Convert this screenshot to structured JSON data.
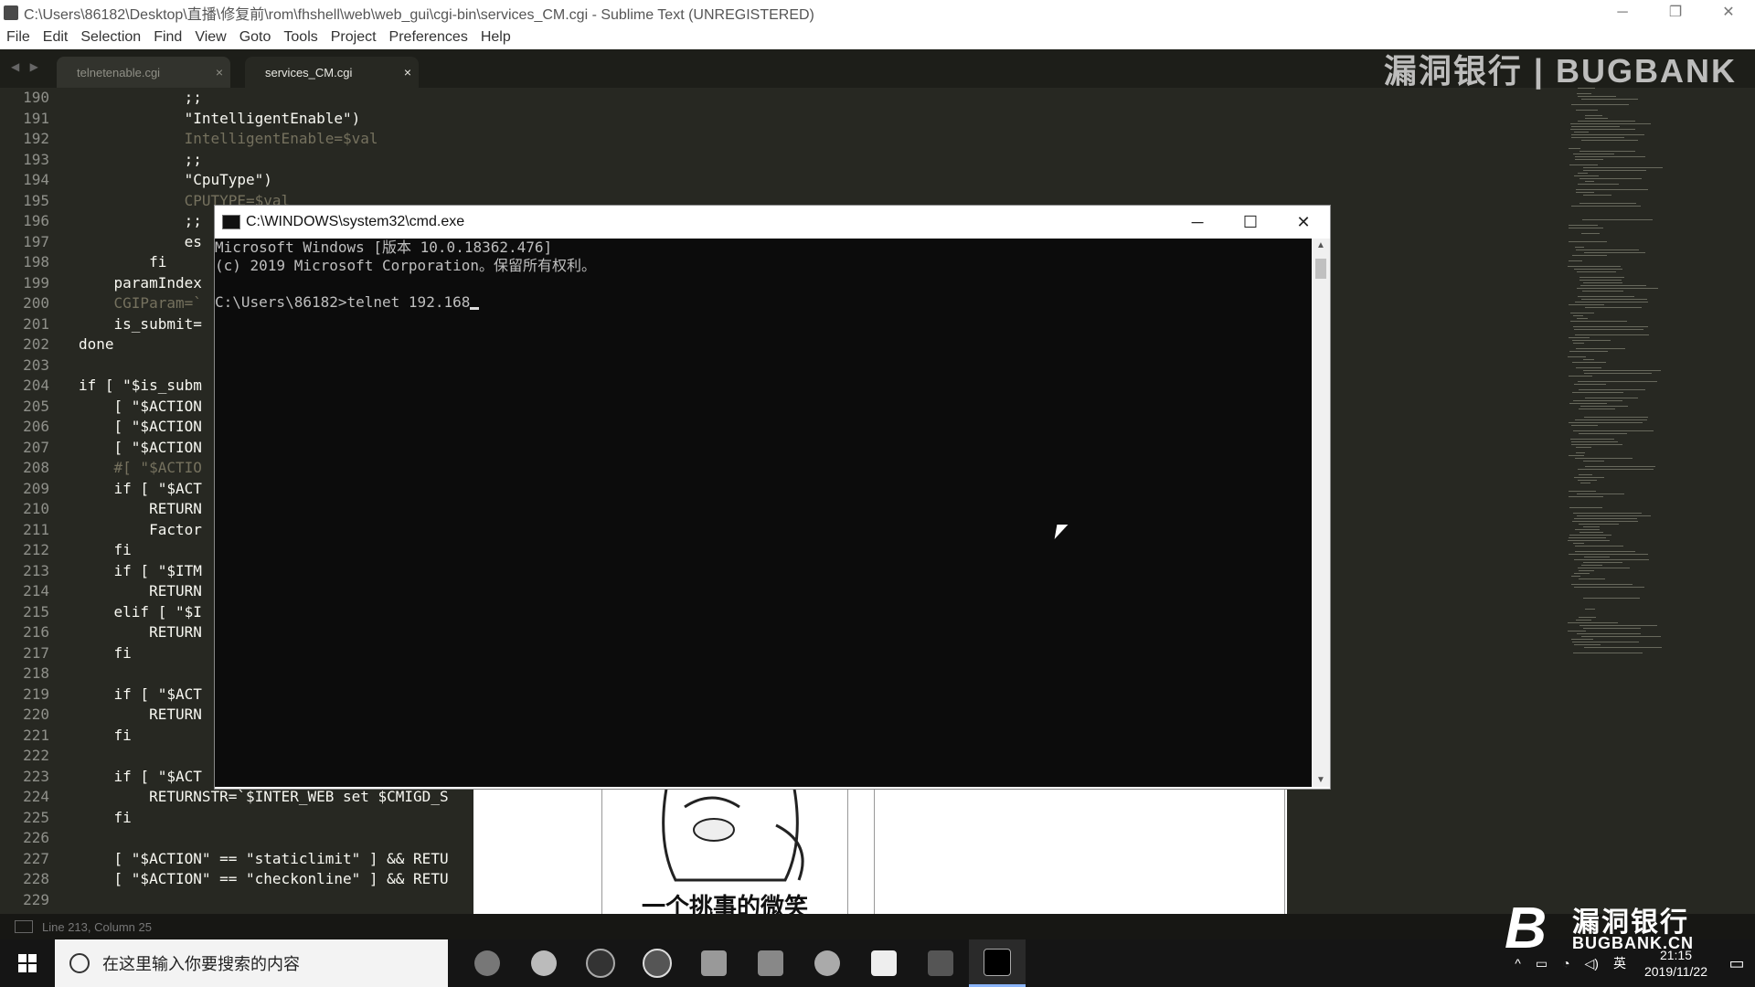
{
  "window": {
    "title": "C:\\Users\\86182\\Desktop\\直播\\修复前\\rom\\fhshell\\web\\web_gui\\cgi-bin\\services_CM.cgi - Sublime Text (UNREGISTERED)",
    "controls": [
      "─",
      "❐",
      "✕"
    ]
  },
  "menu": [
    "File",
    "Edit",
    "Selection",
    "Find",
    "View",
    "Goto",
    "Tools",
    "Project",
    "Preferences",
    "Help"
  ],
  "tabs": [
    {
      "label": "telnetenable.cgi",
      "close": "×"
    },
    {
      "label": "services_CM.cgi",
      "close": "×"
    }
  ],
  "tab_nav": "◀ ▶",
  "watermark_top": "漏洞银行 | BUGBANK",
  "editor": {
    "line_numbers": [
      "190",
      "191",
      "192",
      "193",
      "194",
      "195",
      "196",
      "197",
      "198",
      "199",
      "200",
      "201",
      "202",
      "203",
      "204",
      "205",
      "206",
      "207",
      "208",
      "209",
      "210",
      "211",
      "212",
      "213",
      "214",
      "215",
      "216",
      "217",
      "218",
      "219",
      "220",
      "221",
      "222",
      "223",
      "224",
      "225",
      "226",
      "227",
      "228",
      "229"
    ],
    "lines": [
      "            ;;",
      "            \"IntelligentEnable\")",
      "            IntelligentEnable=$val",
      "            ;;",
      "            \"CpuType\")",
      "            CPUTYPE=$val",
      "            ;;",
      "            es",
      "        fi",
      "    paramIndex",
      "    CGIParam=`",
      "    is_submit=",
      "done",
      "",
      "if [ \"$is_subm",
      "    [ \"$ACTION",
      "    [ \"$ACTION",
      "    [ \"$ACTION",
      "    #[ \"$ACTIO",
      "    if [ \"$ACT",
      "        RETURN",
      "        Factor",
      "    fi",
      "    if [ \"$ITM",
      "        RETURN",
      "    elif [ \"$I",
      "        RETURN",
      "    fi",
      "",
      "    if [ \"$ACT",
      "        RETURN",
      "    fi",
      "",
      "    if [ \"$ACT",
      "        RETURNSTR=`$INTER_WEB set $CMIGD_S",
      "    fi",
      "",
      "    [ \"$ACTION\" == \"staticlimit\" ] && RETU",
      "    [ \"$ACTION\" == \"checkonline\" ] && RETU",
      ""
    ]
  },
  "status": "Line 213, Column 25",
  "cmd": {
    "title": "C:\\WINDOWS\\system32\\cmd.exe",
    "controls": [
      "─",
      "☐",
      "✕"
    ],
    "lines": [
      "Microsoft Windows [版本 10.0.18362.476]",
      "(c) 2019 Microsoft Corporation。保留所有权利。",
      "",
      "C:\\Users\\86182>telnet 192.168"
    ]
  },
  "sticker": {
    "caption": "一个挑事的微笑"
  },
  "taskbar": {
    "search_placeholder": "在这里输入你要搜索的内容",
    "tray_icons": [
      "^",
      "▭",
      "◔",
      "◁)",
      "英"
    ],
    "time": "21:15",
    "date": "2019/11/22",
    "notification": "▭"
  },
  "watermark_br": {
    "logo": "B",
    "line1": "漏洞银行",
    "line2": "BUGBANK.CN"
  }
}
